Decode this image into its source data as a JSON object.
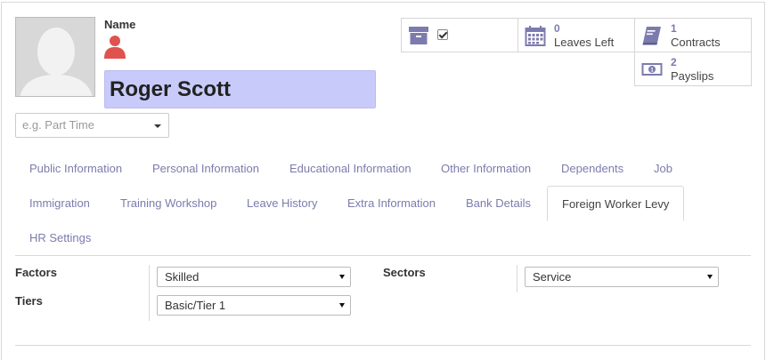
{
  "employee": {
    "name_label": "Name",
    "name": "Roger Scott",
    "job_placeholder": "e.g. Part Time"
  },
  "smart_buttons": {
    "archive": {
      "icon": "archive-icon",
      "checked": true
    },
    "leaves": {
      "count": "0",
      "label": "Leaves Left",
      "icon": "calendar-icon"
    },
    "contracts": {
      "count": "1",
      "label": "Contracts",
      "icon": "book-icon"
    },
    "payslips": {
      "count": "2",
      "label": "Payslips",
      "icon": "money-icon"
    }
  },
  "tabs": [
    {
      "label": "Public Information"
    },
    {
      "label": "Personal Information"
    },
    {
      "label": "Educational Information"
    },
    {
      "label": "Other Information"
    },
    {
      "label": "Dependents"
    },
    {
      "label": "Job"
    },
    {
      "label": "Immigration"
    },
    {
      "label": "Training Workshop"
    },
    {
      "label": "Leave History"
    },
    {
      "label": "Extra Information"
    },
    {
      "label": "Bank Details"
    },
    {
      "label": "Foreign Worker Levy",
      "active": true
    },
    {
      "label": "HR Settings"
    }
  ],
  "levy": {
    "factors_label": "Factors",
    "factors_value": "Skilled",
    "tiers_label": "Tiers",
    "tiers_value": "Basic/Tier 1",
    "sectors_label": "Sectors",
    "sectors_value": "Service"
  },
  "colors": {
    "accent": "#7c7bad",
    "name_field_bg": "#c8cbfa",
    "status_icon": "#e0524e"
  }
}
